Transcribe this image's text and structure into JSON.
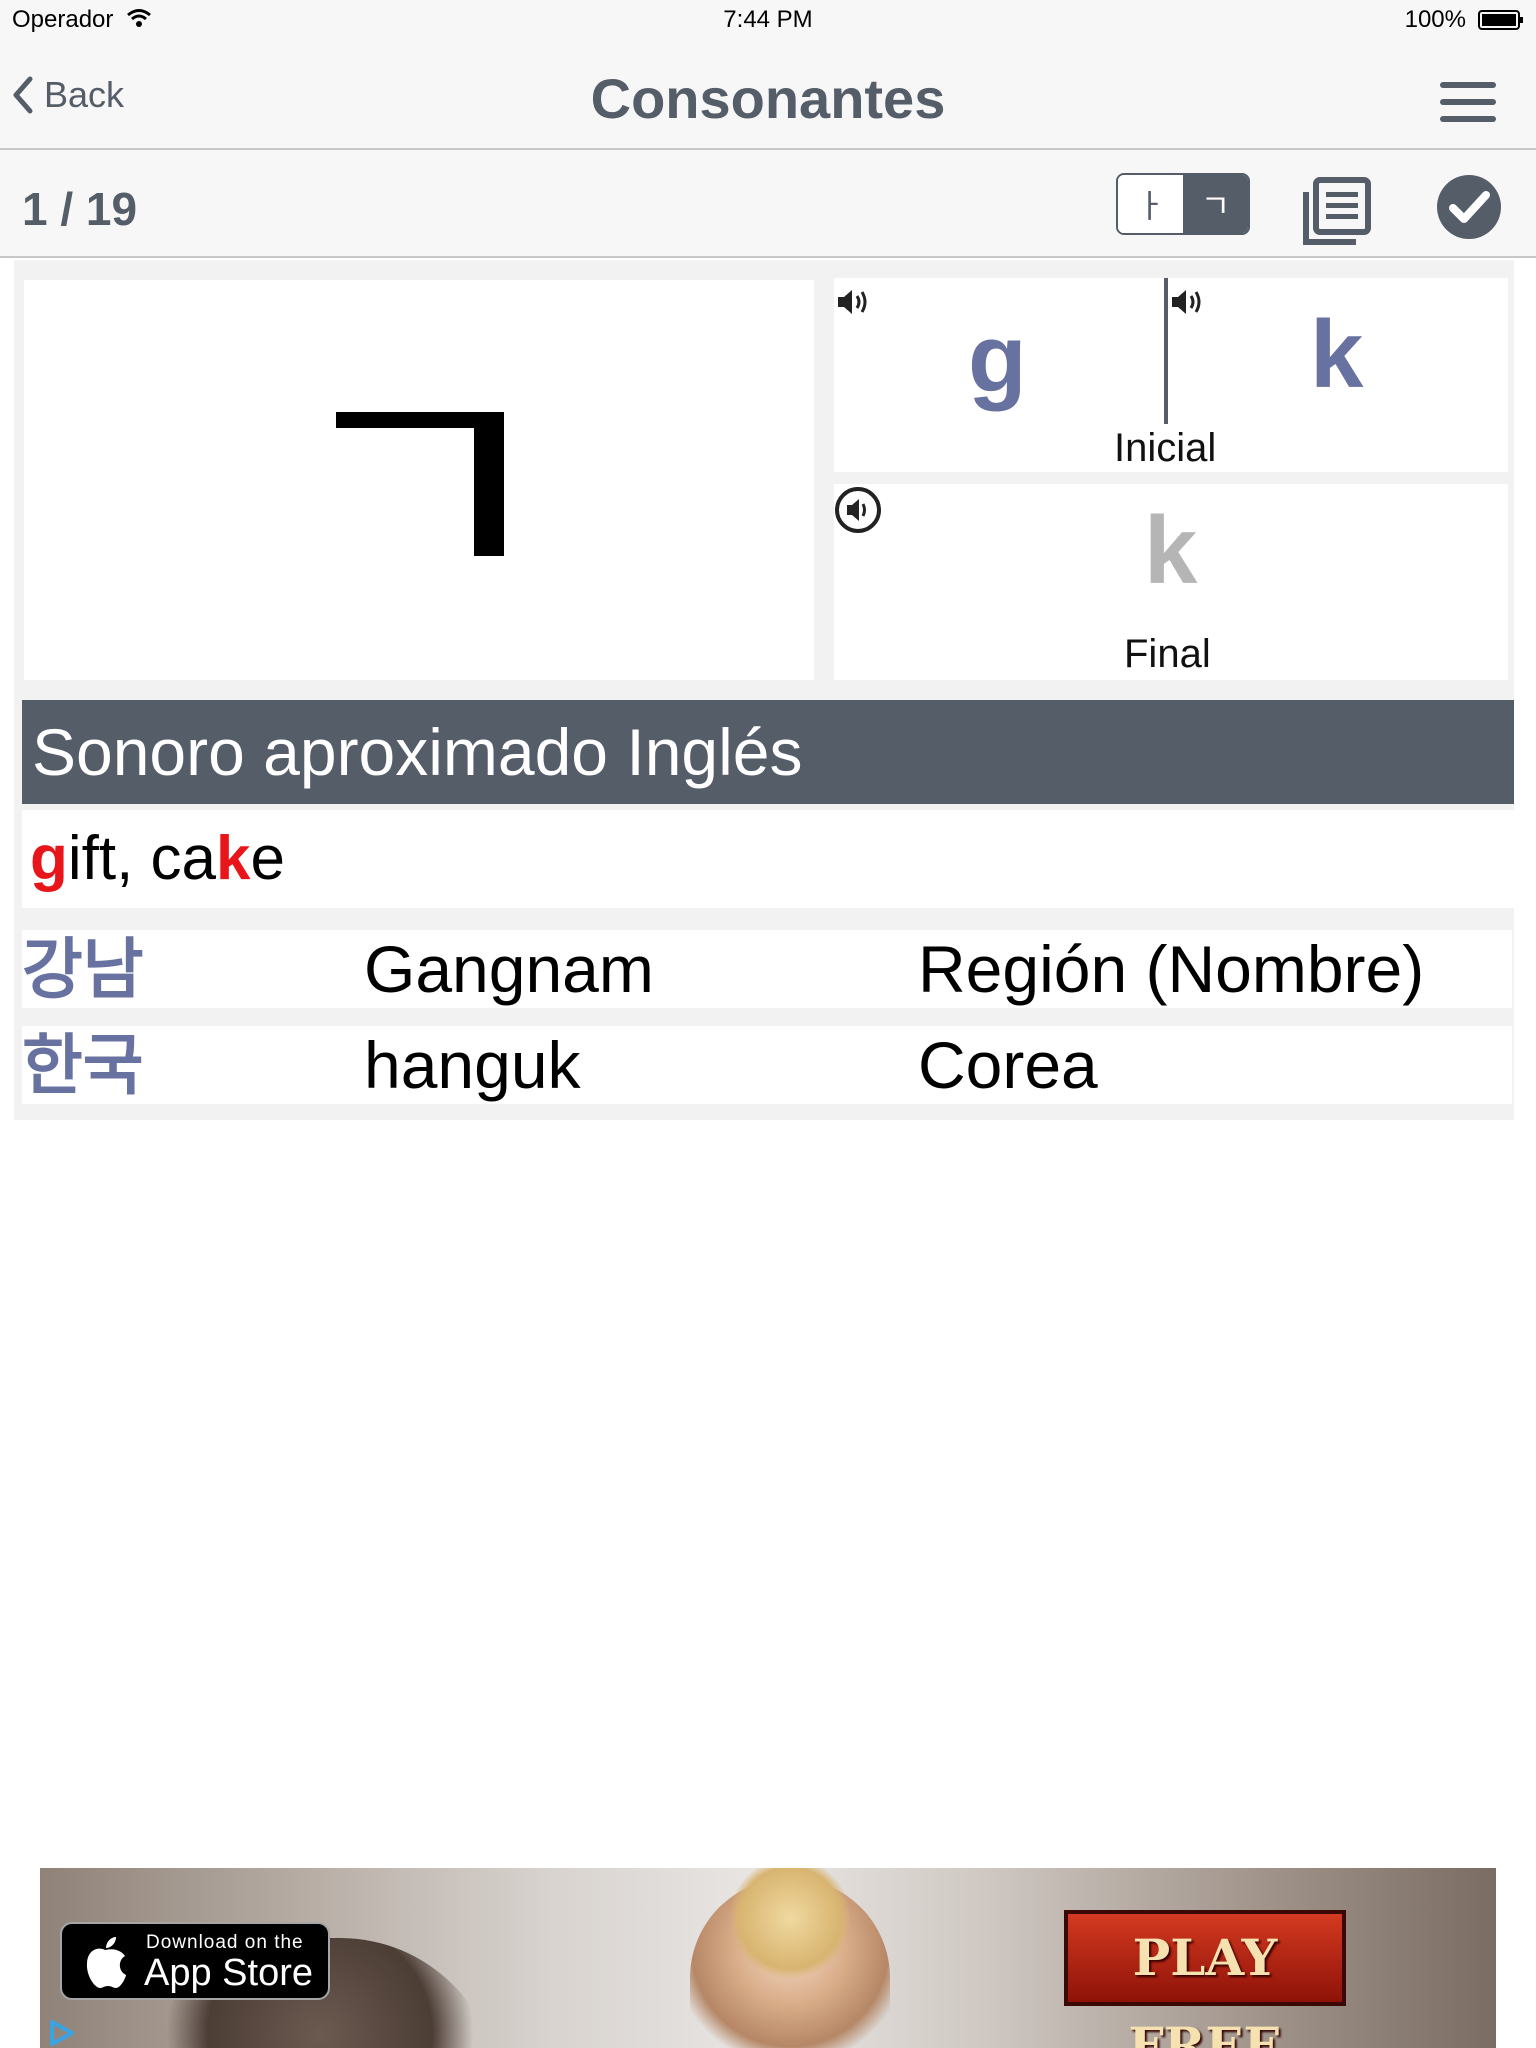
{
  "status_bar": {
    "carrier": "Operador",
    "time": "7:44 PM",
    "battery": "100%"
  },
  "nav": {
    "back_label": "Back",
    "title": "Consonantes"
  },
  "toolbar": {
    "counter": "1 / 19",
    "segment": {
      "left": "ㅏ",
      "right": "ㄱ",
      "selected": "right"
    }
  },
  "card": {
    "character": "ㄱ",
    "initial": {
      "voiced": "g",
      "unvoiced": "k",
      "label": "Inicial"
    },
    "final": {
      "letter": "k",
      "label": "Final"
    }
  },
  "section": {
    "header": "Sonoro aproximado Inglés",
    "example": [
      {
        "text": "g",
        "highlight": true
      },
      {
        "text": "ift, ca",
        "highlight": false
      },
      {
        "text": "k",
        "highlight": true
      },
      {
        "text": "e",
        "highlight": false
      }
    ]
  },
  "words": [
    {
      "korean": "강남",
      "romanized": "Gangnam",
      "meaning": "Región (Nombre)"
    },
    {
      "korean": "한국",
      "romanized": "hanguk",
      "meaning": "Corea"
    }
  ],
  "ad": {
    "store_small": "Download on the",
    "store_big": "App Store",
    "cta": "PLAY FREE"
  },
  "colors": {
    "accent": "#555d68",
    "letter": "#6872a0",
    "highlight": "#e8161b",
    "grey_letter": "#b5b5b5"
  }
}
